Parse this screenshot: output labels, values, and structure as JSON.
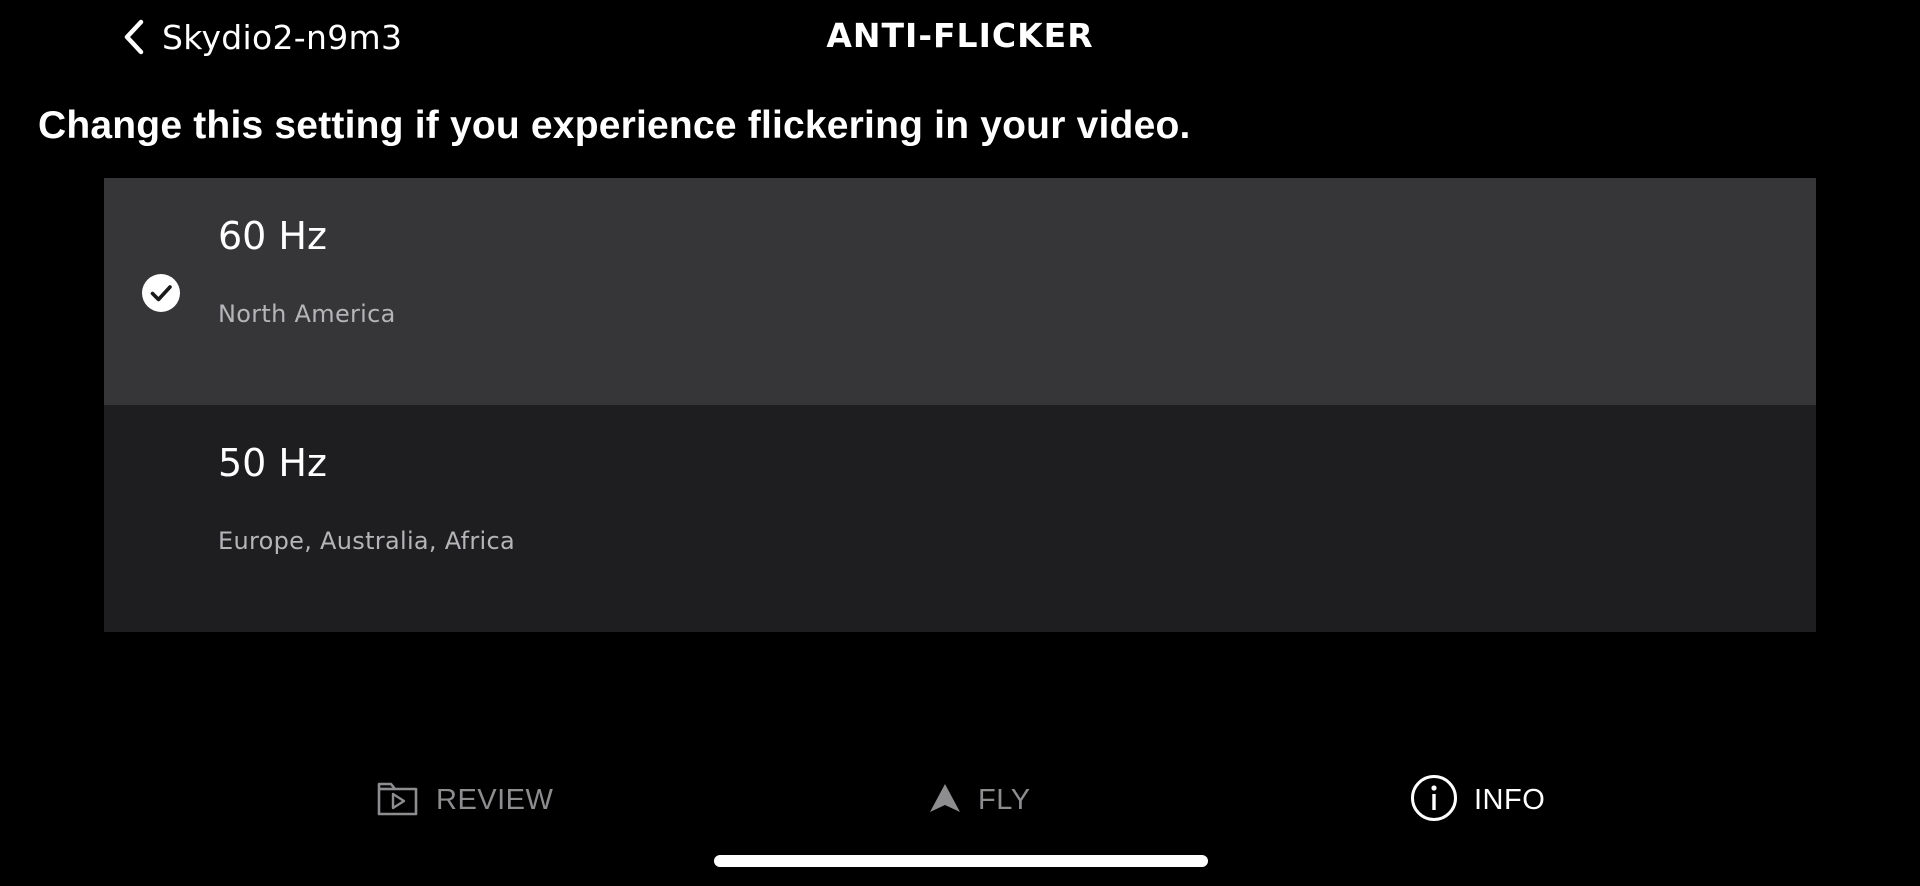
{
  "header": {
    "back_label": "Skydio2-n9m3",
    "back_icon": "chevron-left-icon",
    "title": "ANTI-FLICKER"
  },
  "description": "Change this setting if you experience flickering in your video.",
  "options": [
    {
      "title": "60 Hz",
      "subtitle": "North America",
      "selected": true
    },
    {
      "title": "50 Hz",
      "subtitle": "Europe, Australia, Africa",
      "selected": false
    }
  ],
  "bottom_nav": [
    {
      "label": "REVIEW",
      "icon": "folder-play-icon",
      "active": false
    },
    {
      "label": "FLY",
      "icon": "navigation-arrow-icon",
      "active": false
    },
    {
      "label": "INFO",
      "icon": "info-icon",
      "active": true
    }
  ],
  "colors": {
    "background": "#000000",
    "selected_row": "#363538",
    "unselected_row": "#1e1d20",
    "inactive_nav": "#8d8d90",
    "active_nav": "#ffffff"
  }
}
